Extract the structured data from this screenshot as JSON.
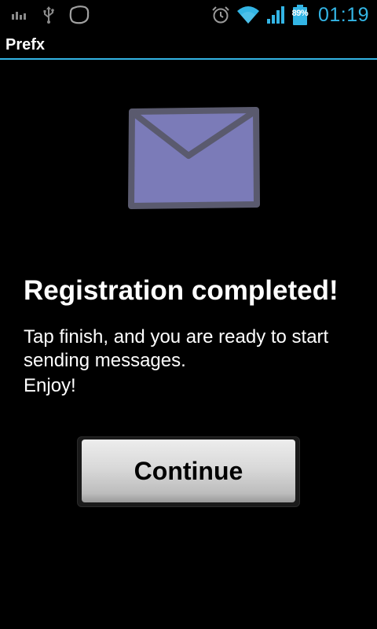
{
  "status_bar": {
    "left_icons": [
      "bar-chart-notification-icon",
      "usb-icon",
      "app-notification-icon"
    ],
    "right_icons": [
      "alarm-icon",
      "wifi-icon",
      "cell-signal-icon",
      "battery-icon"
    ],
    "battery_percent": "89%",
    "time": "01:19",
    "clock_color": "#33b5e5"
  },
  "title_bar": {
    "title": "Prefx",
    "accent_color": "#33b5e5"
  },
  "content": {
    "icon": "envelope-icon",
    "icon_color": "#7b7bb8",
    "headline": "Registration completed!",
    "body": "Tap finish, and you are ready to start sending messages.",
    "enjoy": "Enjoy!"
  },
  "actions": {
    "continue_label": "Continue"
  }
}
